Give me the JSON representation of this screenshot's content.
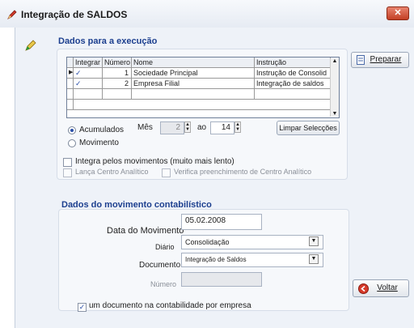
{
  "window": {
    "title": "Integração de SALDOS",
    "close_symbol": "✕"
  },
  "execucao": {
    "section_title": "Dados para a execução",
    "table": {
      "headers": [
        "Integrar",
        "Número",
        "Nome",
        "Instrução"
      ],
      "rows": [
        {
          "integrar": "✓",
          "numero": "1",
          "nome": "Sociedade Principal",
          "instrucao": "Instrução de Consolid"
        },
        {
          "integrar": "✓",
          "numero": "2",
          "nome": "Empresa Filial",
          "instrucao": "Integração de saldos"
        }
      ]
    },
    "preparar_label": "Preparar",
    "radio_acumulados": "Acumulados",
    "radio_movimento": "Movimento",
    "mes_label": "Mês",
    "mes_from": "2",
    "ao_label": "ao",
    "mes_to": "14",
    "limpar_label": "Limpar Selecções",
    "integra_label": "Integra pelos movimentos (muito mais lento)",
    "lanca_label": "Lança Centro Analítico",
    "verifica_label": "Verifica preenchimento de Centro Analítico"
  },
  "movimento": {
    "section_title": "Dados do movimento contabilístico",
    "data_label": "Data do Movimento",
    "data_value": "05.02.2008",
    "diario_label": "Diário",
    "diario_value": "Consolidação",
    "documento_label": "Documento",
    "documento_value": "Integração de Saldos",
    "numero_label": "Número",
    "numero_value": "",
    "um_documento_label": "um documento na contabilidade por empresa",
    "voltar_label": "Voltar"
  },
  "icons": {
    "app": "pencil-icon",
    "preparar": "document-icon",
    "voltar": "back-circle-icon"
  },
  "colors": {
    "section_title": "#1c3f8f",
    "close": "#c33f25",
    "window": "#eef2f8"
  }
}
